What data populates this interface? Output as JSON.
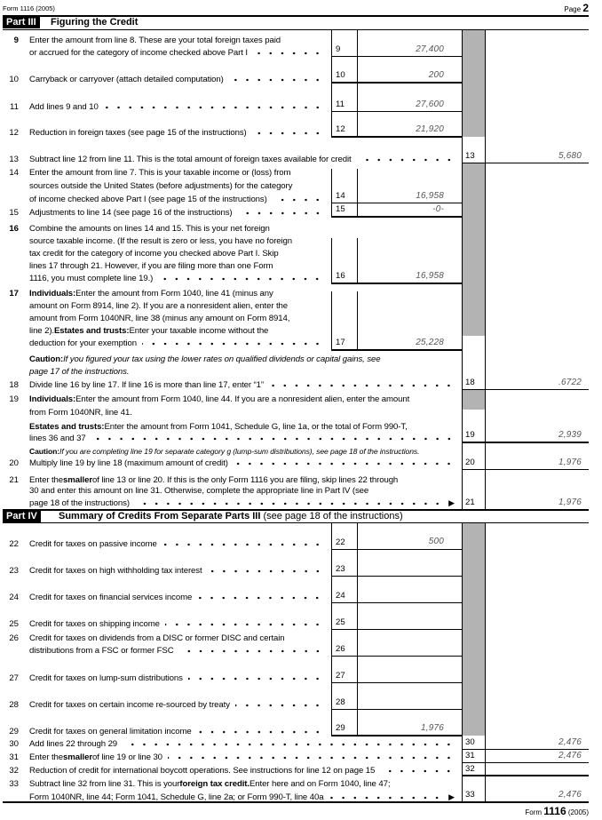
{
  "header": {
    "form_label": "Form 1116 (2005)",
    "page_word": "Page",
    "page_number": "2"
  },
  "part3": {
    "label": "Part III",
    "title": "Figuring the Credit",
    "l9": {
      "num": "9",
      "text": [
        "Enter the amount from line 8. These are your total foreign taxes paid",
        "or accrued for the category of income checked above Part I"
      ],
      "box": "9",
      "value": "27,400"
    },
    "l10": {
      "num": "10",
      "text": [
        "Carryback or carryover (attach detailed computation)"
      ],
      "box": "10",
      "value": "200"
    },
    "l11": {
      "num": "11",
      "text": [
        "Add lines 9 and 10"
      ],
      "box": "11",
      "value": "27,600"
    },
    "l12": {
      "num": "12",
      "text": [
        "Reduction in foreign taxes (see page 15 of the instructions)"
      ],
      "box": "12",
      "value": "21,920"
    },
    "l13": {
      "num": "13",
      "text": [
        "Subtract line 12 from line 11. This is the total amount of foreign taxes available for credit"
      ],
      "box": "13",
      "value": "5,680"
    },
    "l14": {
      "num": "14",
      "text": [
        "Enter the amount from line 7. This is your taxable income or (loss) from",
        "sources outside the United States (before adjustments) for the category",
        "of income checked above Part I (see page 15 of the instructions)"
      ],
      "box": "14",
      "value": "16,958"
    },
    "l15": {
      "num": "15",
      "text": [
        "Adjustments to line 14 (see page 16 of the instructions)"
      ],
      "box": "15",
      "value": "-0-"
    },
    "l16": {
      "num": "16",
      "text": [
        "Combine the amounts on lines 14 and 15. This is your net foreign",
        "source taxable income. (If the result is zero or less, you have no foreign",
        "tax credit for the category of income you checked above Part I. Skip",
        "lines 17 through 21. However, if you are filing more than one Form",
        "1116, you must complete line 19.)"
      ],
      "box": "16",
      "value": "16,958"
    },
    "l17": {
      "num": "17",
      "text": [
        [
          "Individuals:",
          " Enter the amount from Form 1040, line 41 (minus any"
        ],
        [
          "amount on Form 8914, line 2). If you are a nonresident alien, enter the"
        ],
        [
          "amount from Form 1040NR, line 38 (minus any amount on Form 8914,"
        ],
        [
          "line 2). ",
          "Estates and trusts:",
          " Enter your taxable income without the"
        ],
        [
          "deduction for your exemption"
        ]
      ],
      "box": "17",
      "value": "25,228"
    },
    "caution1": {
      "label": "Caution:",
      "text": [
        " If you figured your tax using the lower rates on qualified dividends or capital gains, see",
        "page 17 of the instructions."
      ]
    },
    "l18": {
      "num": "18",
      "text": [
        "Divide line 16 by line 17. If line 16 is more than line 17, enter “1”"
      ],
      "box": "18",
      "value": ".6722"
    },
    "l19": {
      "num": "19",
      "text": [
        [
          "Individuals:",
          " Enter the amount from Form 1040, line 44. If you are a nonresident alien, enter the amount"
        ],
        [
          "from Form 1040NR, line 41."
        ],
        [
          "Estates and trusts:",
          " Enter the amount from Form 1041, Schedule G, line 1a, or the total of Form 990-T,"
        ],
        [
          "lines 36 and 37"
        ]
      ],
      "box": "19",
      "value": "2,939"
    },
    "caution2": {
      "label": "Caution:",
      "text": " If you are completing line 19 for separate category g (lump-sum distributions), see page 18 of the instructions."
    },
    "l20": {
      "num": "20",
      "text": [
        "Multiply line 19 by line 18 (maximum amount of credit)"
      ],
      "box": "20",
      "value": "1,976"
    },
    "l21": {
      "num": "21",
      "text": [
        [
          "Enter the ",
          "smaller",
          " of line 13 or line 20. If this is the only Form 1116 you are filing, skip lines 22 through"
        ],
        [
          "30 and enter this amount on line 31. Otherwise, complete the appropriate line in Part IV (see"
        ],
        [
          "page 18 of the instructions)"
        ]
      ],
      "box": "21",
      "value": "1,976",
      "arrow": "▶"
    }
  },
  "part4": {
    "label": "Part IV",
    "title": "Summary of Credits From Separate Parts III",
    "title_note": " (see page 18 of the instructions)",
    "l22": {
      "num": "22",
      "text": [
        "Credit for taxes on passive income"
      ],
      "box": "22",
      "value": "500"
    },
    "l23": {
      "num": "23",
      "text": [
        "Credit for taxes on high withholding tax interest"
      ],
      "box": "23",
      "value": ""
    },
    "l24": {
      "num": "24",
      "text": [
        "Credit for taxes on financial services income"
      ],
      "box": "24",
      "value": ""
    },
    "l25": {
      "num": "25",
      "text": [
        "Credit for taxes on shipping income"
      ],
      "box": "25",
      "value": ""
    },
    "l26": {
      "num": "26",
      "text": [
        "Credit for taxes on dividends from a DISC or former DISC and certain",
        "distributions from a FSC or former FSC"
      ],
      "box": "26",
      "value": ""
    },
    "l27": {
      "num": "27",
      "text": [
        "Credit for taxes on lump-sum distributions"
      ],
      "box": "27",
      "value": ""
    },
    "l28": {
      "num": "28",
      "text": [
        "Credit for taxes on certain income re-sourced by treaty"
      ],
      "box": "28",
      "value": ""
    },
    "l29": {
      "num": "29",
      "text": [
        "Credit for taxes on general limitation income"
      ],
      "box": "29",
      "value": "1,976"
    },
    "l30": {
      "num": "30",
      "text": [
        "Add lines 22 through 29"
      ],
      "box": "30",
      "value": "2,476"
    },
    "l31": {
      "num": "31",
      "text": [
        [
          "Enter the ",
          "smaller",
          " of line 19 or line 30"
        ]
      ],
      "box": "31",
      "value": "2,476"
    },
    "l32": {
      "num": "32",
      "text": [
        "Reduction of credit for international boycott operations. See instructions for line 12 on page 15"
      ],
      "box": "32",
      "value": ""
    },
    "l33": {
      "num": "33",
      "text": [
        [
          "Subtract line 32 from line 31. This is your ",
          "foreign tax credit.",
          " Enter here and on Form 1040, line 47;"
        ],
        [
          "Form 1040NR, line 44; Form 1041, Schedule G, line 2a; or Form 990-T, line 40a"
        ]
      ],
      "box": "33",
      "value": "2,476",
      "arrow": "▶"
    }
  },
  "footer": {
    "form_word": "Form",
    "form_number": "1116",
    "year": "(2005)"
  },
  "colors": {
    "shade": "#b3b3b3",
    "entry_text": "#555555"
  }
}
